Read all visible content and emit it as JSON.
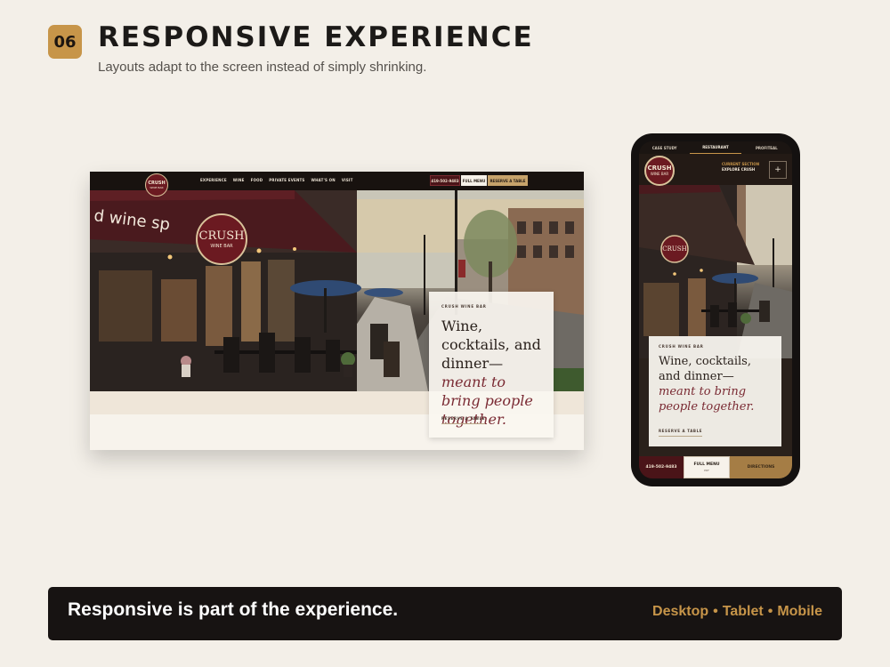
{
  "header": {
    "step_number": "06",
    "title": "RESPONSIVE EXPERIENCE",
    "subtitle": "Layouts adapt to the screen instead of simply shrinking."
  },
  "desktop": {
    "logo": {
      "name": "CRUSH",
      "tag": "WINE BAR"
    },
    "nav": [
      "EXPERIENCE",
      "WINE",
      "FOOD",
      "PRIVATE EVENTS",
      "WHAT'S ON",
      "VISIT"
    ],
    "phone_button": "419-502-9483",
    "menu_button": "FULL MENU",
    "reserve_button": "RESERVE A TABLE",
    "card": {
      "eyebrow": "CRUSH WINE BAR",
      "headline": "Wine, cocktails, and dinner—",
      "accent": "meant to bring people together.",
      "cta": "RESERVE A TABLE"
    },
    "photo": {
      "awning_text": "d  wine  sp",
      "sign_text": "CRUSH",
      "sign_sub": "WINE BAR"
    }
  },
  "mobile": {
    "tabs": [
      "CASE STUDY",
      "RESTAURANT",
      "PROFITEAL"
    ],
    "active_tab": "RESTAURANT",
    "logo": {
      "name": "CRUSH",
      "tag": "WINE BAR"
    },
    "section_label": "CURRENT SECTION",
    "section_name": "EXPLORE CRUSH",
    "plus": "+",
    "card": {
      "eyebrow": "CRUSH WINE BAR",
      "headline": "Wine, cocktails, and dinner—",
      "accent": "meant to bring people together.",
      "cta": "RESERVE A TABLE"
    },
    "call_button": "419-502-9483",
    "menu_button": "FULL MENU",
    "menu_sub": "PDF",
    "directions_button": "DIRECTIONS"
  },
  "footer": {
    "message": "Responsive is part of the experience.",
    "devices": [
      "Desktop",
      "Tablet",
      "Mobile"
    ],
    "separator": "•"
  },
  "colors": {
    "background": "#f3efe8",
    "accent_gold": "#c79549",
    "wine": "#6b1a21",
    "dark": "#171312"
  }
}
